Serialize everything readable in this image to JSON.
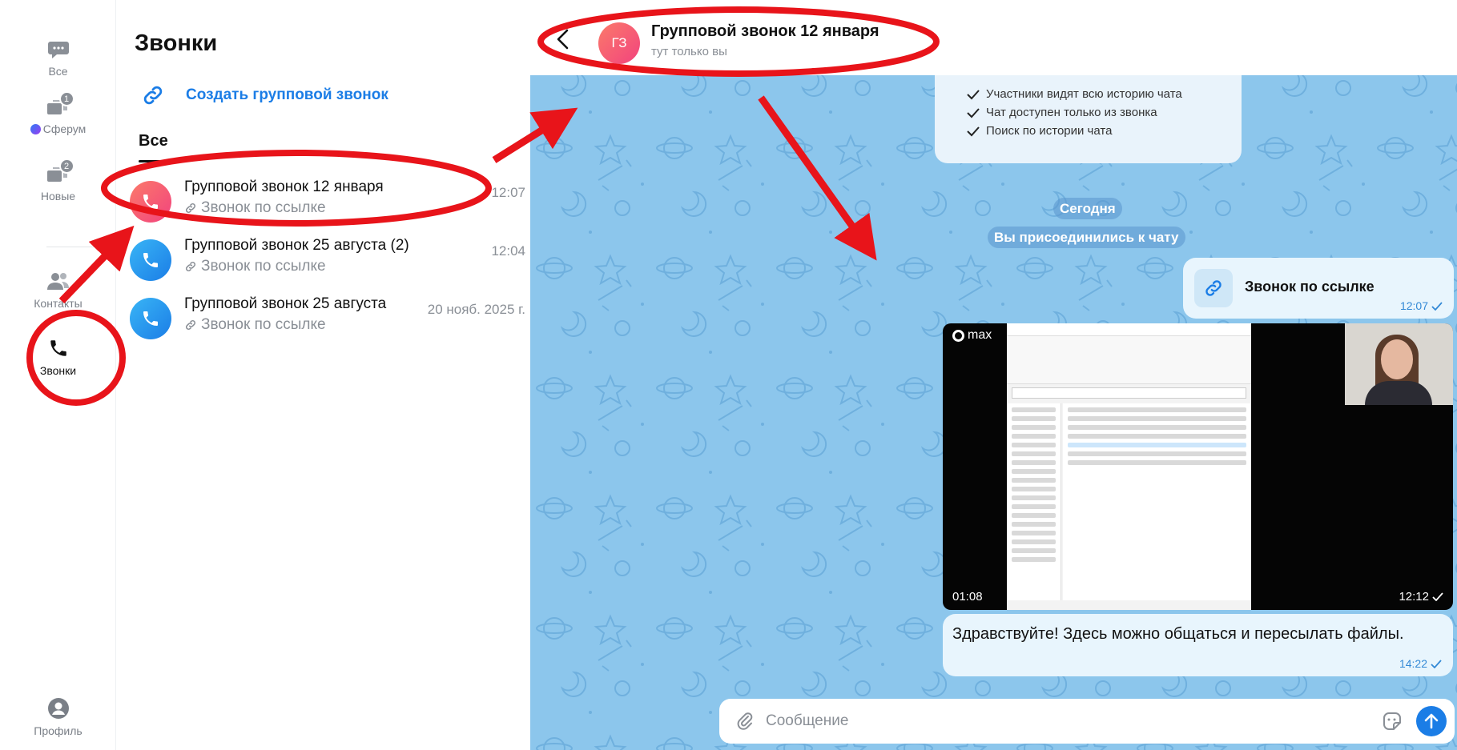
{
  "rail": {
    "items": [
      {
        "label": "Все",
        "icon": "chat-bubble-icon",
        "badge": ""
      },
      {
        "label": "Сферум",
        "icon": "chat-group-icon",
        "badge": "1"
      },
      {
        "label": "Новые",
        "icon": "chat-group-icon",
        "badge": "2"
      },
      {
        "label": "Контакты",
        "icon": "contacts-icon",
        "badge": ""
      },
      {
        "label": "Звонки",
        "icon": "phone-icon",
        "badge": ""
      }
    ],
    "profile_label": "Профиль"
  },
  "calls": {
    "title": "Звонки",
    "create_label": "Создать групповой звонок",
    "tab_all": "Все",
    "items": [
      {
        "name": "Групповой звонок 12 января",
        "sub": "Звонок по ссылке",
        "time": "12:07"
      },
      {
        "name": "Групповой звонок 25 августа (2)",
        "sub": "Звонок по ссылке",
        "time": "12:04"
      },
      {
        "name": "Групповой звонок 25 августа",
        "sub": "Звонок по ссылке",
        "time": "20 нояб. 2025 г."
      }
    ]
  },
  "chat": {
    "avatar_initials": "ГЗ",
    "title": "Групповой звонок 12 января",
    "subtitle": "тут только вы",
    "info_lines": [
      "Участники видят всю историю чата",
      "Чат доступен только из звонка",
      "Поиск по истории чата"
    ],
    "date_pill": "Сегодня",
    "joined_pill": "Вы присоединились к чату",
    "link_message": {
      "title": "Звонок по ссылке",
      "time": "12:07"
    },
    "video_message": {
      "logo": "max",
      "duration": "01:08",
      "time": "12:12"
    },
    "text_message": {
      "text": "Здравствуйте! Здесь можно общаться и пересылать файлы.",
      "time": "14:22"
    },
    "composer_placeholder": "Сообщение"
  },
  "colors": {
    "accent": "#1b7de6",
    "annotation": "#e8141a",
    "chat_bg": "#8cc6ec",
    "bubble": "#e8f5fd"
  }
}
